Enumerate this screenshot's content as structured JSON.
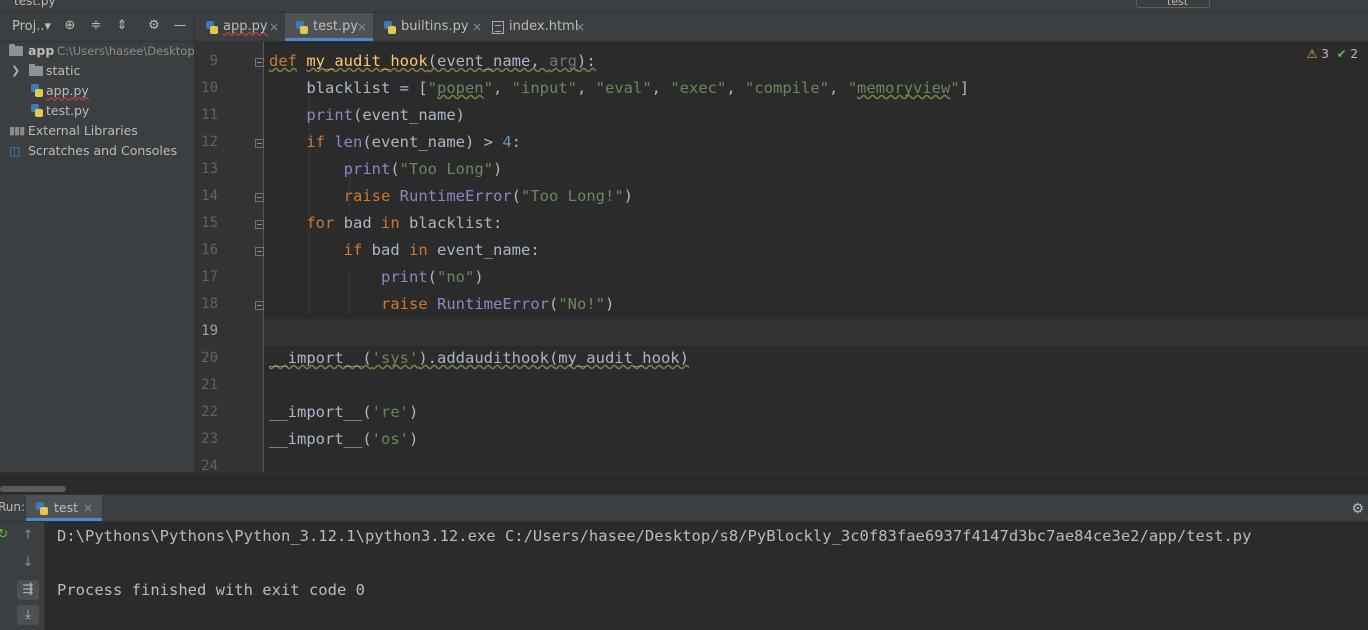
{
  "top": {
    "crumb": "test.py",
    "run_config": "test"
  },
  "project": {
    "title": "Proj..▾",
    "root": {
      "name": "app",
      "path": "C:\\Users\\hasee\\Desktop"
    },
    "items": [
      {
        "label": "static"
      },
      {
        "label": "app.py"
      },
      {
        "label": "test.py"
      },
      {
        "label": "External Libraries"
      },
      {
        "label": "Scratches and Consoles"
      }
    ]
  },
  "tabs": [
    {
      "label": "app.py"
    },
    {
      "label": "test.py"
    },
    {
      "label": "builtins.py"
    },
    {
      "label": "index.html"
    }
  ],
  "tab_close": "×",
  "inspections": {
    "warnings": "3",
    "checks": "2"
  },
  "editor": {
    "line_numbers": [
      "9",
      "10",
      "11",
      "12",
      "13",
      "14",
      "15",
      "16",
      "17",
      "18",
      "19",
      "20",
      "21",
      "22",
      "23",
      "24"
    ],
    "current_line": "19"
  },
  "run": {
    "label": "Run:",
    "tab": "test",
    "command": "D:\\Pythons\\Pythons\\Python_3.12.1\\python3.12.exe C:/Users/hasee/Desktop/s8/PyBlockly_3c0f83fae6937f4147d3bc7ae84ce3e2/app/test.py",
    "result": "Process finished with exit code 0"
  },
  "colors": {
    "keyword": "#cc7832",
    "function": "#ffc66d",
    "string": "#6a8759",
    "number": "#6897bb",
    "builtin": "#8888c6",
    "accent": "#4a88c7",
    "background": "#2b2b2b",
    "panel": "#3c3f41"
  },
  "icons": [
    "target-icon",
    "expand-all-icon",
    "collapse-all-icon",
    "gear-icon",
    "minimize-icon",
    "python-file-icon",
    "html-file-icon",
    "folder-icon",
    "library-icon",
    "scratch-icon",
    "warning-icon",
    "check-icon",
    "rerun-icon",
    "up-arrow-icon",
    "down-arrow-icon",
    "soft-wrap-icon",
    "scroll-end-icon"
  ]
}
